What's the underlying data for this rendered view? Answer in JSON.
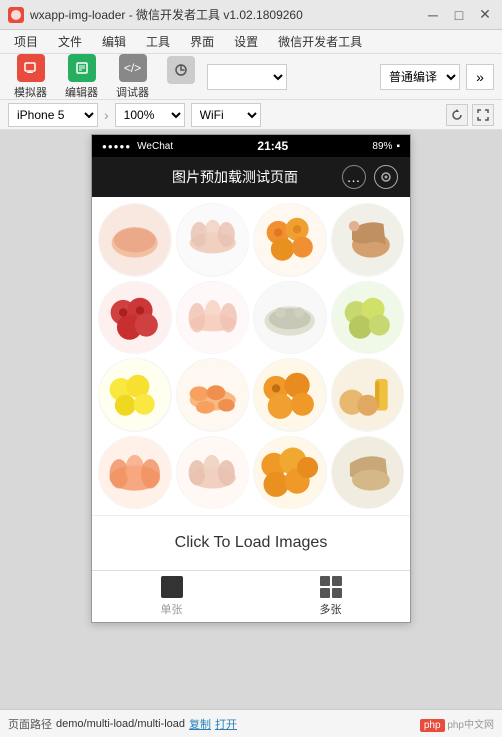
{
  "window": {
    "title": "wxapp-img-loader - 微信开发者工具 v1.02.1809260",
    "title_icon": "W"
  },
  "menu": {
    "items": [
      "项目",
      "文件",
      "编辑",
      "工具",
      "界面",
      "设置",
      "微信开发者工具"
    ]
  },
  "toolbar": {
    "simulator_label": "模拟器",
    "editor_label": "编辑器",
    "debugger_label": "调试器",
    "compile_dropdown": "",
    "mode_select": "普通编译",
    "expand_btn": "»"
  },
  "device_bar": {
    "device": "iPhone 5",
    "zoom": "100%",
    "network": "WiFi",
    "rotate_icon": "↻",
    "fullscreen_icon": "⛶"
  },
  "phone": {
    "status_bar": {
      "dots": "●●●●●",
      "app_name": "WeChat",
      "time": "21:45",
      "battery_pct": "89%",
      "battery_icon": "🔋"
    },
    "nav_bar": {
      "title": "图片预加载测试页面",
      "more_icon": "•••",
      "circle_icon": "○"
    },
    "images": [
      {
        "id": 1,
        "color": "#f8e0d0",
        "food": "sliced-meat"
      },
      {
        "id": 2,
        "color": "#f0d0d0",
        "food": "pork-slices"
      },
      {
        "id": 3,
        "color": "#f5a050",
        "food": "oranges"
      },
      {
        "id": 4,
        "color": "#e8c8a0",
        "food": "meat-leg"
      },
      {
        "id": 5,
        "color": "#e05050",
        "food": "apples"
      },
      {
        "id": 6,
        "color": "#f8d8d0",
        "food": "fish-fillet"
      },
      {
        "id": 7,
        "color": "#d0d8d0",
        "food": "fish"
      },
      {
        "id": 8,
        "color": "#d0e0a0",
        "food": "pears"
      },
      {
        "id": 9,
        "color": "#f8e870",
        "food": "lemons"
      },
      {
        "id": 10,
        "color": "#f8a060",
        "food": "shrimp"
      },
      {
        "id": 11,
        "color": "#f8a030",
        "food": "oranges2"
      },
      {
        "id": 12,
        "color": "#f0b060",
        "food": "snacks"
      },
      {
        "id": 13,
        "color": "#f8c0a0",
        "food": "salmon"
      },
      {
        "id": 14,
        "color": "#f0d8c0",
        "food": "pork2"
      },
      {
        "id": 15,
        "color": "#f8a030",
        "food": "citrus"
      },
      {
        "id": 16,
        "color": "#e8c8b0",
        "food": "meat2"
      }
    ],
    "load_btn_label": "Click To Load Images",
    "tabs": [
      {
        "label": "单张",
        "active": false,
        "icon": "single"
      },
      {
        "label": "多张",
        "active": true,
        "icon": "multi"
      }
    ]
  },
  "status_footer": {
    "path_label": "页面路径",
    "path_value": "demo/multi-load/multi-load",
    "copy_label": "复制",
    "open_label": "打开",
    "logo": "php中文网"
  }
}
